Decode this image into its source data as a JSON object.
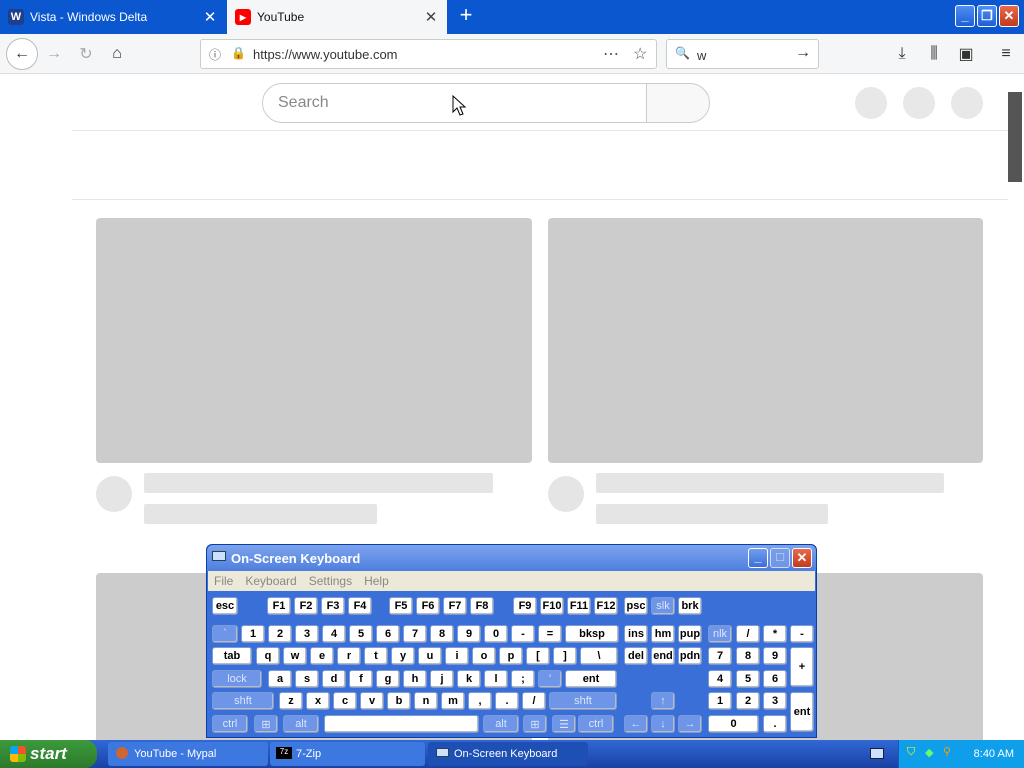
{
  "browser": {
    "tabs": [
      {
        "label": "Vista - Windows Delta",
        "icon": "W"
      },
      {
        "label": "YouTube",
        "icon": "youtube-icon"
      }
    ],
    "url": "https://www.youtube.com",
    "search_value": "w"
  },
  "youtube": {
    "search_placeholder": "Search"
  },
  "osk": {
    "title": "On-Screen Keyboard",
    "menu": [
      "File",
      "Keyboard",
      "Settings",
      "Help"
    ],
    "rows": {
      "fn": [
        "esc",
        "F1",
        "F2",
        "F3",
        "F4",
        "F5",
        "F6",
        "F7",
        "F8",
        "F9",
        "F10",
        "F11",
        "F12",
        "psc",
        "slk",
        "brk"
      ],
      "num": [
        "`",
        "1",
        "2",
        "3",
        "4",
        "5",
        "6",
        "7",
        "8",
        "9",
        "0",
        "-",
        "=",
        "bksp",
        "ins",
        "hm",
        "pup",
        "nlk",
        "/",
        "*",
        "-"
      ],
      "q": [
        "tab",
        "q",
        "w",
        "e",
        "r",
        "t",
        "y",
        "u",
        "i",
        "o",
        "p",
        "[",
        "]",
        "\\",
        "del",
        "end",
        "pdn",
        "7",
        "8",
        "9",
        "+"
      ],
      "a": [
        "lock",
        "a",
        "s",
        "d",
        "f",
        "g",
        "h",
        "j",
        "k",
        "l",
        ";",
        "'",
        "ent",
        "4",
        "5",
        "6"
      ],
      "z": [
        "shft",
        "z",
        "x",
        "c",
        "v",
        "b",
        "n",
        "m",
        ",",
        ".",
        "/",
        "shft",
        "1",
        "2",
        "3",
        "ent"
      ],
      "bottom": [
        "ctrl",
        "alt",
        "alt",
        "ctrl",
        "0",
        "."
      ]
    }
  },
  "taskbar": {
    "start": "start",
    "tasks": [
      "YouTube - Mypal",
      "7-Zip",
      "On-Screen Keyboard"
    ],
    "time": "8:40 AM"
  }
}
